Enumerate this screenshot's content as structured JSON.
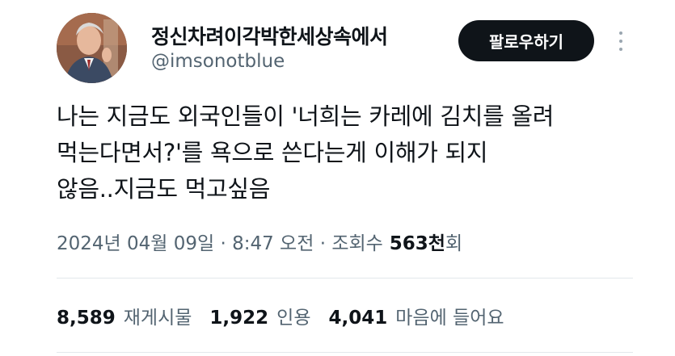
{
  "author": {
    "display_name": "정신차려이각박한세상속에서",
    "handle": "@imsonotblue"
  },
  "follow_label": "팔로우하기",
  "tweet": {
    "lines": [
      "나는 지금도 외국인들이 '너희는 카레에 김치를 올려",
      "먹는다면서?'를 욕으로 쓴다는게 이해가 되지",
      "않음..지금도 먹고싶음"
    ]
  },
  "meta": {
    "datetime": "2024년 04월 09일 · 8:47 오전 · 조회수",
    "views_count": "563천",
    "views_suffix": "회"
  },
  "stats": {
    "retweets": {
      "count": "8,589",
      "label": "재게시물"
    },
    "quotes": {
      "count": "1,922",
      "label": "인용"
    },
    "likes": {
      "count": "4,041",
      "label": "마음에 들어요"
    }
  }
}
